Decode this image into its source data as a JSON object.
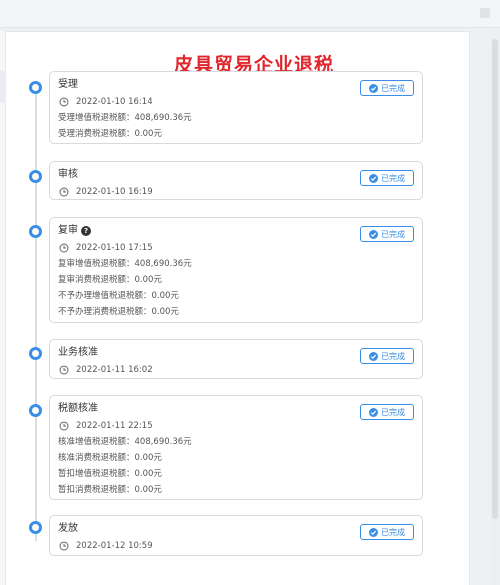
{
  "title": "皮具贸易企业退税",
  "status_label": "已完成",
  "steps": [
    {
      "name": "受理",
      "time": "2022-01-10 16:14",
      "details": [
        "受理增值税退税额：408,690.36元",
        "受理消费税退税额：0.00元"
      ]
    },
    {
      "name": "审核",
      "time": "2022-01-10 16:19",
      "details": []
    },
    {
      "name": "复审",
      "time": "2022-01-10 17:15",
      "help_icon": "question-circle-icon",
      "details": [
        "复审增值税退税额：408,690.36元",
        "复审消费税退税额：0.00元",
        "不予办理增值税退税额：0.00元",
        "不予办理消费税退税额：0.00元"
      ]
    },
    {
      "name": "业务核准",
      "time": "2022-01-11 16:02",
      "details": []
    },
    {
      "name": "税额核准",
      "time": "2022-01-11 22:15",
      "details": [
        "核准增值税退税额：408,690.36元",
        "核准消费税退税额：0.00元",
        "暂扣增值税退税额：0.00元",
        "暂扣消费税退税额：0.00元"
      ]
    },
    {
      "name": "发放",
      "time": "2022-01-12 10:59",
      "details": []
    }
  ],
  "colors": {
    "accent": "#3a8ee6",
    "title": "#e0262c"
  }
}
